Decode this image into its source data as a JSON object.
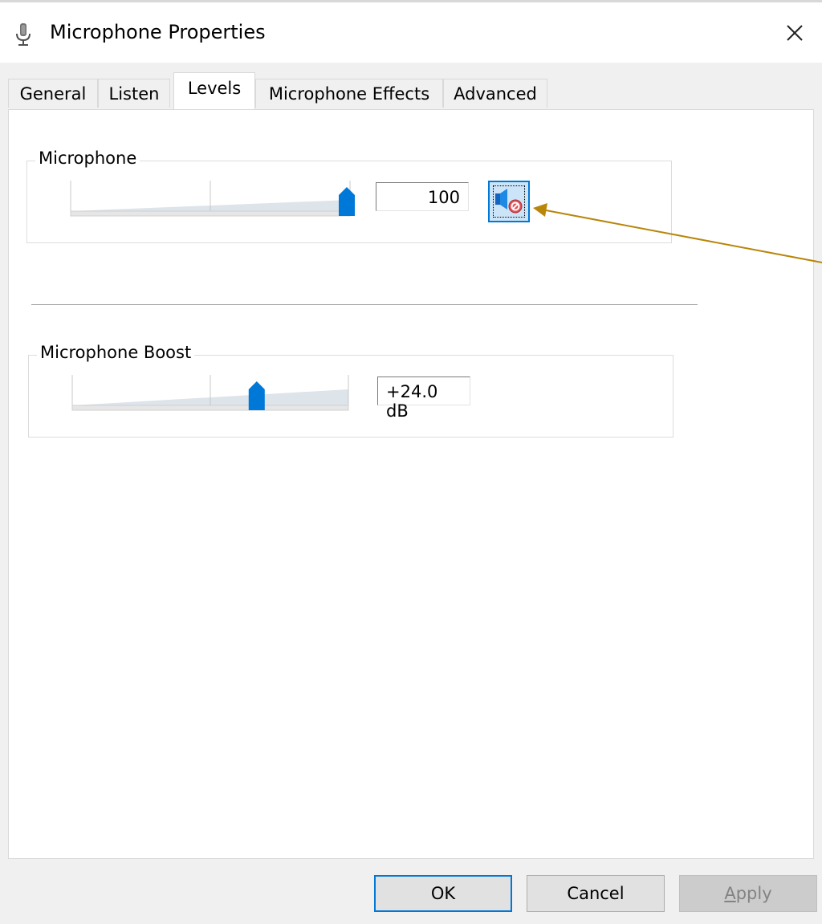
{
  "window": {
    "title": "Microphone Properties",
    "title_icon": "microphone-icon",
    "close_icon": "close-icon"
  },
  "tabs": [
    {
      "label": "General",
      "active": false
    },
    {
      "label": "Listen",
      "active": false
    },
    {
      "label": "Levels",
      "active": true
    },
    {
      "label": "Microphone Effects",
      "active": false
    },
    {
      "label": "Advanced",
      "active": false
    }
  ],
  "levels": {
    "microphone": {
      "label": "Microphone",
      "value": "100",
      "level_fraction": 1.0,
      "mute_icon": "speaker-muted-icon"
    },
    "boost": {
      "label": "Microphone Boost",
      "value": "+24.0 dB",
      "level_fraction": 0.67
    }
  },
  "buttons": {
    "ok": "OK",
    "cancel": "Cancel",
    "apply": "Apply",
    "apply_enabled": false
  },
  "colors": {
    "accent": "#0078d7",
    "annotation_arrow": "#b8860b",
    "mute_badge": "#e0525a"
  }
}
